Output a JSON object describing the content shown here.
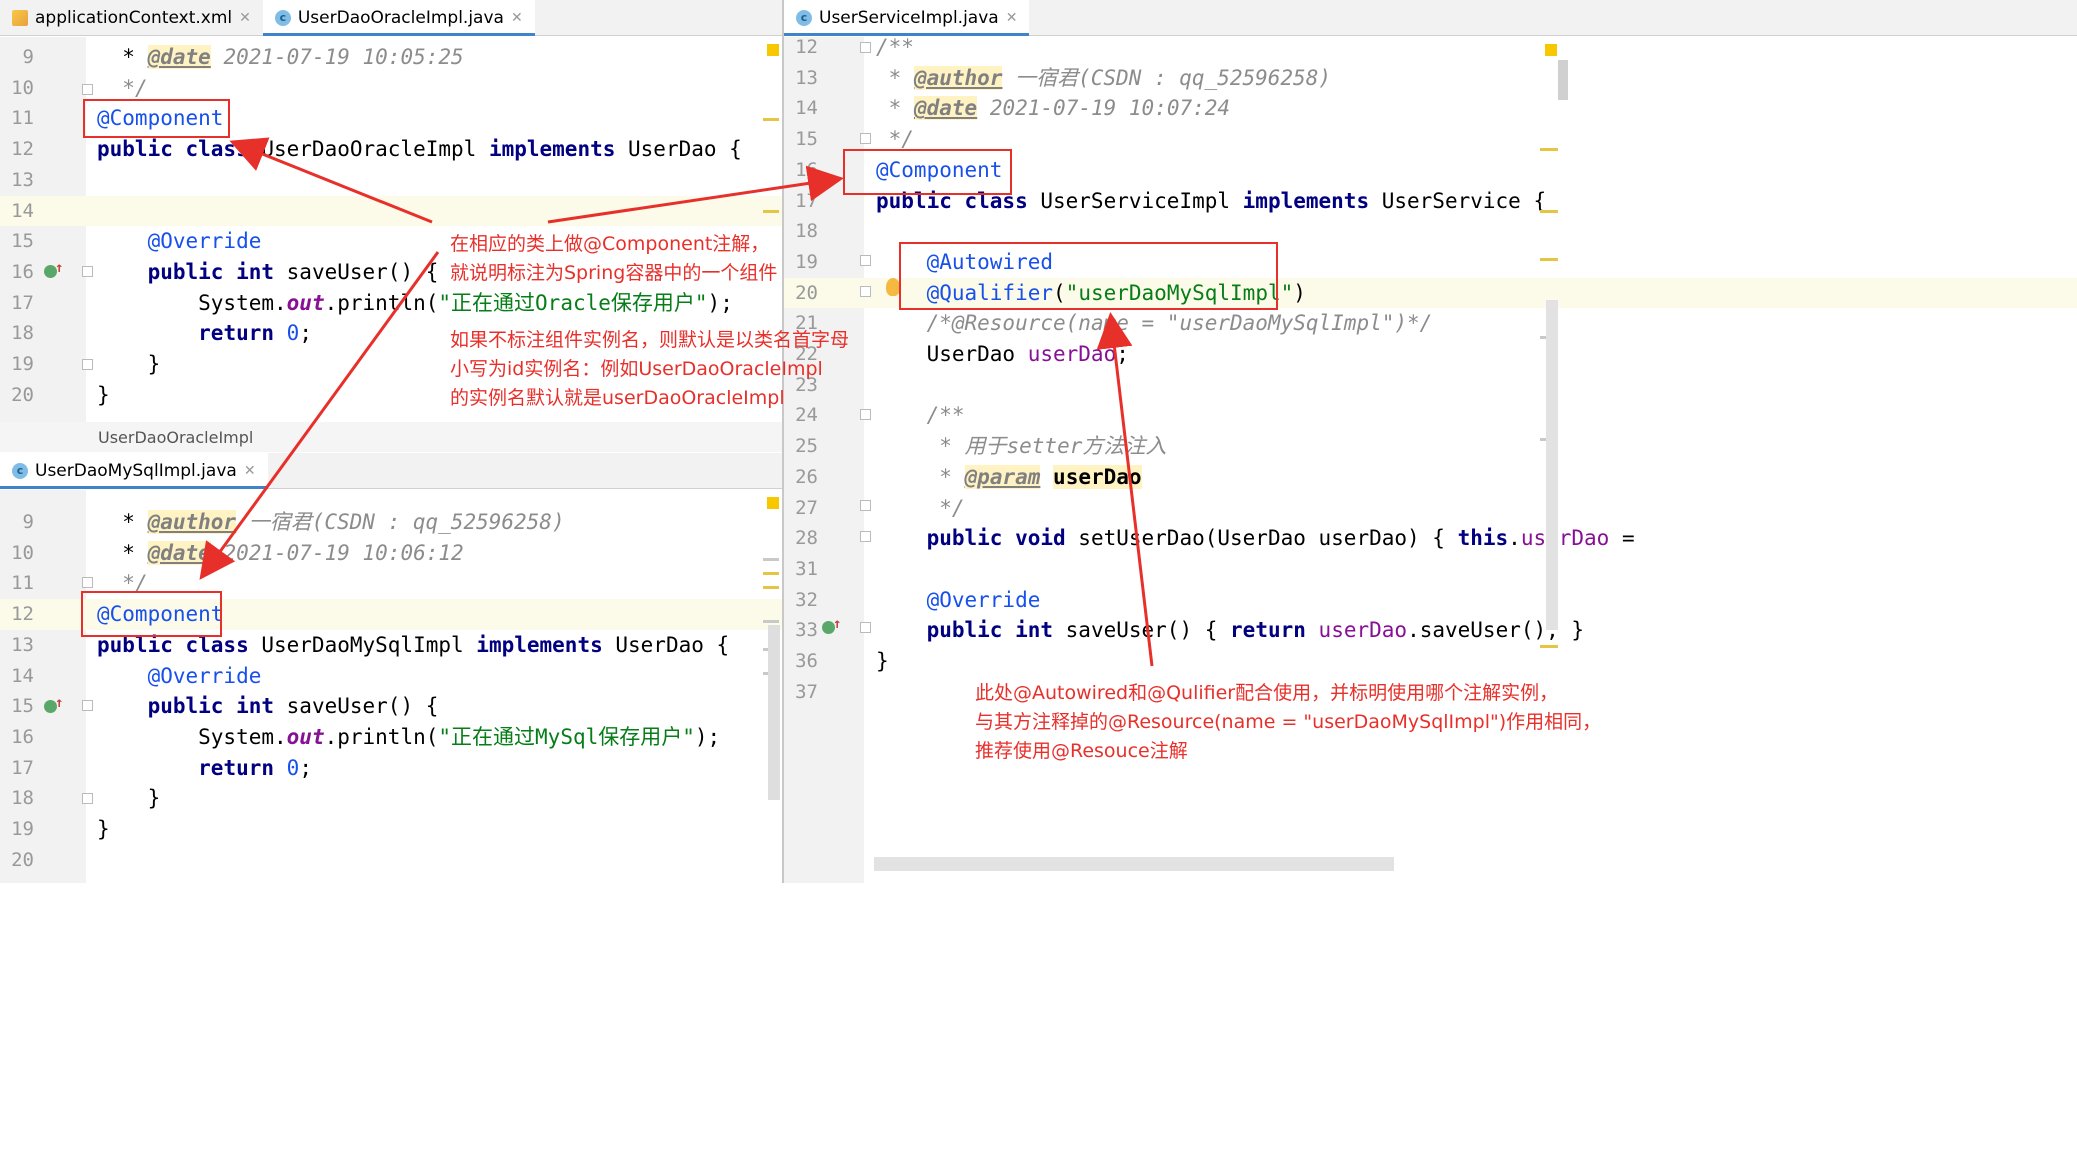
{
  "left_top": {
    "tabs": [
      {
        "icon": "xml-icon",
        "label": "applicationContext.xml"
      },
      {
        "icon": "class-icon",
        "label": "UserDaoOracleImpl.java"
      }
    ],
    "breadcrumb": "UserDaoOracleImpl",
    "lines": [
      {
        "n": "9",
        "html": "  * <span class='tag'>@date</span><span class='cm'> 2021-07-19 10:05:25</span>"
      },
      {
        "n": "10",
        "html": "  <span class='cm'>*/</span>"
      },
      {
        "n": "11",
        "html": "<span class='ann'>@Component</span>"
      },
      {
        "n": "12",
        "html": "<span class='kw'>public class</span> UserDaoOracleImpl <span class='kw'>implements</span> UserDao {"
      },
      {
        "n": "13",
        "html": ""
      },
      {
        "n": "14",
        "html": ""
      },
      {
        "n": "15",
        "html": "    <span class='ann'>@Override</span>"
      },
      {
        "n": "16",
        "html": "    <span class='kw'>public int</span> saveUser() {"
      },
      {
        "n": "17",
        "html": "        System.<span class='fld'>out</span>.println(<span class='str'>\"正在通过Oracle保存用户\"</span>);"
      },
      {
        "n": "18",
        "html": "        <span class='kw'>return</span> <span class='num'>0</span>;"
      },
      {
        "n": "19",
        "html": "    }"
      },
      {
        "n": "20",
        "html": "}"
      }
    ]
  },
  "left_bottom": {
    "tabs": [
      {
        "icon": "class-icon",
        "label": "UserDaoMySqlImpl.java"
      }
    ],
    "lines": [
      {
        "n": "9",
        "html": "  * <span class='tag'>@author</span><span class='cm'> 一宿君(CSDN : qq_52596258)</span>"
      },
      {
        "n": "10",
        "html": "  * <span class='tag'>@date</span><span class='cm'> 2021-07-19 10:06:12</span>"
      },
      {
        "n": "11",
        "html": "  <span class='cm'>*/</span>"
      },
      {
        "n": "12",
        "html": "<span class='ann'>@Component</span>"
      },
      {
        "n": "13",
        "html": "<span class='kw'>public class</span> UserDaoMySqlImpl <span class='kw'>implements</span> UserDao {"
      },
      {
        "n": "14",
        "html": "    <span class='ann'>@Override</span>"
      },
      {
        "n": "15",
        "html": "    <span class='kw'>public int</span> saveUser() {"
      },
      {
        "n": "16",
        "html": "        System.<span class='fld'>out</span>.println(<span class='str'>\"正在通过MySql保存用户\"</span>);"
      },
      {
        "n": "17",
        "html": "        <span class='kw'>return</span> <span class='num'>0</span>;"
      },
      {
        "n": "18",
        "html": "    }"
      },
      {
        "n": "19",
        "html": "}"
      },
      {
        "n": "20",
        "html": ""
      }
    ]
  },
  "right": {
    "tabs": [
      {
        "icon": "class-icon",
        "label": "UserServiceImpl.java"
      }
    ],
    "lines": [
      {
        "n": "12",
        "html": "<span class='cm'>/**</span>"
      },
      {
        "n": "13",
        "html": " <span class='cm'>*</span> <span class='tag'>@author</span><span class='cm'> 一宿君(CSDN : qq_52596258)</span>"
      },
      {
        "n": "14",
        "html": " <span class='cm'>*</span> <span class='tag'>@date</span><span class='cm'> 2021-07-19 10:07:24</span>"
      },
      {
        "n": "15",
        "html": " <span class='cm'>*/</span>"
      },
      {
        "n": "16",
        "html": "<span class='ann'>@Component</span>"
      },
      {
        "n": "17",
        "html": "<span class='kw'>public class</span> UserServiceImpl <span class='kw'>implements</span> UserService {"
      },
      {
        "n": "18",
        "html": ""
      },
      {
        "n": "19",
        "html": "    <span class='ann'>@Autowired</span>"
      },
      {
        "n": "20",
        "html": "    <span class='ann'>@Qualifier</span>(<span class='str'>\"userDaoMySqlImpl\"</span>)"
      },
      {
        "n": "21",
        "html": "    <span class='cm'>/*@Resource(name = \"userDaoMySqlImpl\")*/</span>"
      },
      {
        "n": "22",
        "html": "    UserDao <span class='fldn'>userDao</span>;"
      },
      {
        "n": "23",
        "html": ""
      },
      {
        "n": "24",
        "html": "    <span class='cm'>/**</span>"
      },
      {
        "n": "25",
        "html": "    <span class='cm'> * 用于setter方法注入</span>"
      },
      {
        "n": "26",
        "html": "    <span class='cm'> *</span> <span class='tag'>@param</span> <span class='bold' style='background:#fff3c4'>userDao</span>"
      },
      {
        "n": "27",
        "html": "    <span class='cm'> */</span>"
      },
      {
        "n": "28",
        "html": "    <span class='kw'>public void</span> setUserDao(UserDao userDao) { <span class='kw'>this</span>.<span class='fldn'>userDao</span> ="
      },
      {
        "n": "31",
        "html": ""
      },
      {
        "n": "32",
        "html": "    <span class='ann'>@Override</span>"
      },
      {
        "n": "33",
        "html": "    <span class='kw'>public int</span> saveUser() { <span class='kw'>return</span> <span class='fldn'>userDao</span>.saveUser(); }"
      },
      {
        "n": "36",
        "html": "}"
      },
      {
        "n": "37",
        "html": ""
      }
    ]
  },
  "annotations": {
    "note1": "在相应的类上做@Component注解，\n就说明标注为Spring容器中的一个组件",
    "note2": "如果不标注组件实例名，则默认是以类名首字母\n小写为id实例名：例如UserDaoOracleImpl\n的实例名默认就是userDaoOracleImpl",
    "note3": "此处@Autowired和@Qulifier配合使用，并标明使用哪个注解实例，\n与其方注释掉的@Resource(name = \"userDaoMySqlImpl\")作用相同，\n推荐使用@Resouce注解"
  },
  "colors": {
    "annotation_red": "#e8302b",
    "tab_accent": "#4083c9",
    "keyword": "#000080",
    "string": "#067d17",
    "annotation": "#1750eb"
  }
}
